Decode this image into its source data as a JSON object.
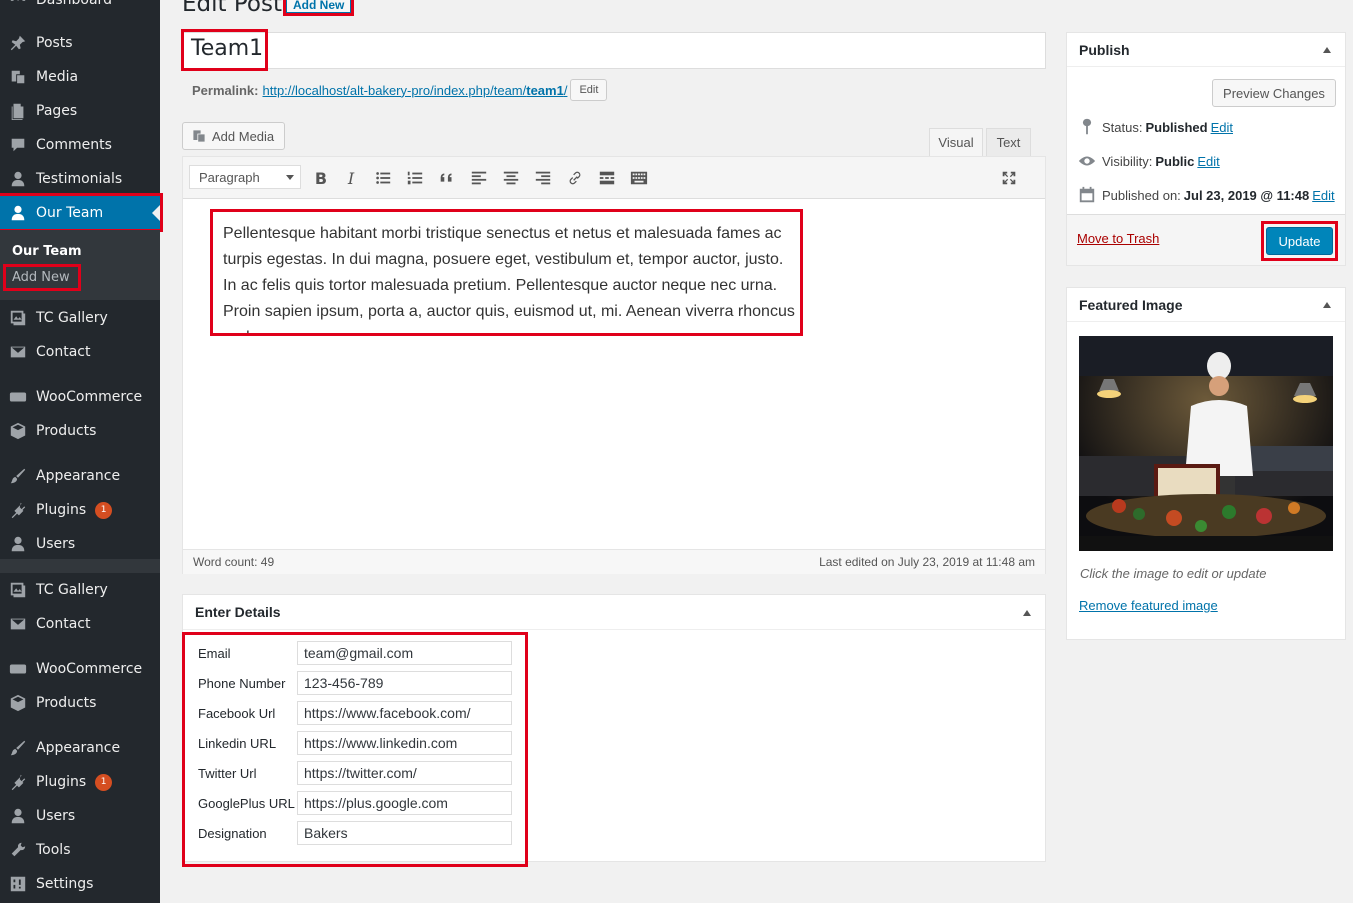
{
  "page": {
    "heading": "Edit Post",
    "add_new_label": "Add New"
  },
  "sidebar": {
    "dashboard_label": "Dashboard",
    "items": [
      {
        "label": "Posts",
        "icon": "pin-icon"
      },
      {
        "label": "Media",
        "icon": "media-icon"
      },
      {
        "label": "Pages",
        "icon": "page-icon"
      },
      {
        "label": "Comments",
        "icon": "comment-icon"
      },
      {
        "label": "Testimonials",
        "icon": "user-icon"
      },
      {
        "label": "Our Team",
        "icon": "user-icon"
      },
      {
        "label": "TC Gallery",
        "icon": "gallery-icon"
      },
      {
        "label": "Contact",
        "icon": "mail-icon"
      },
      {
        "label": "WooCommerce",
        "icon": "woo-icon"
      },
      {
        "label": "Products",
        "icon": "box-icon"
      },
      {
        "label": "Appearance",
        "icon": "brush-icon"
      },
      {
        "label": "Plugins",
        "icon": "plugin-icon",
        "badge": "1"
      },
      {
        "label": "Users",
        "icon": "user-icon"
      },
      {
        "label": "TC Gallery",
        "icon": "gallery-icon"
      },
      {
        "label": "Contact",
        "icon": "mail-icon"
      },
      {
        "label": "WooCommerce",
        "icon": "woo-icon"
      },
      {
        "label": "Products",
        "icon": "box-icon"
      },
      {
        "label": "Appearance",
        "icon": "brush-icon"
      },
      {
        "label": "Plugins",
        "icon": "plugin-icon",
        "badge": "1"
      },
      {
        "label": "Users",
        "icon": "user-icon"
      },
      {
        "label": "Tools",
        "icon": "wrench-icon"
      },
      {
        "label": "Settings",
        "icon": "settings-icon"
      }
    ],
    "submenu": {
      "title": "Our Team",
      "add_new": "Add New"
    }
  },
  "post": {
    "title": "Team1",
    "permalink_label": "Permalink:",
    "permalink_base": "http://localhost/alt-bakery-pro/index.php/team/",
    "permalink_slug": "team1",
    "permalink_trailing": "/",
    "permalink_edit": "Edit"
  },
  "editor": {
    "add_media": "Add Media",
    "tab_visual": "Visual",
    "tab_text": "Text",
    "format": "Paragraph",
    "content": "Pellentesque habitant morbi tristique senectus et netus et malesuada fames ac turpis egestas. In dui magna, posuere eget, vestibulum et, tempor auctor, justo. In ac felis quis tortor malesuada pretium. Pellentesque auctor neque nec urna. Proin sapien ipsum, porta a, auctor quis, euismod ut, mi. Aenean viverra rhoncus pede.",
    "word_count": "Word count: 49",
    "last_edited": "Last edited on July 23, 2019 at 11:48 am"
  },
  "details": {
    "title": "Enter Details",
    "fields": [
      {
        "label": "Email",
        "value": "team@gmail.com"
      },
      {
        "label": "Phone Number",
        "value": "123-456-789"
      },
      {
        "label": "Facebook Url",
        "value": "https://www.facebook.com/"
      },
      {
        "label": "Linkedin URL",
        "value": "https://www.linkedin.com"
      },
      {
        "label": "Twitter Url",
        "value": "https://twitter.com/"
      },
      {
        "label": "GooglePlus URL",
        "value": "https://plus.google.com"
      },
      {
        "label": "Designation",
        "value": "Bakers"
      }
    ]
  },
  "publish": {
    "title": "Publish",
    "preview": "Preview Changes",
    "status_label": "Status:",
    "status_value": "Published",
    "visibility_label": "Visibility:",
    "visibility_value": "Public",
    "published_label": "Published on:",
    "published_value": "Jul 23, 2019 @ 11:48",
    "edit": "Edit",
    "trash": "Move to Trash",
    "update": "Update"
  },
  "featured": {
    "title": "Featured Image",
    "caption": "Click the image to edit or update",
    "remove": "Remove featured image"
  },
  "colors": {
    "accent": "#0073aa",
    "sidebar_bg": "#23282d",
    "highlight": "#e0001a",
    "button_primary": "#0085ba"
  }
}
